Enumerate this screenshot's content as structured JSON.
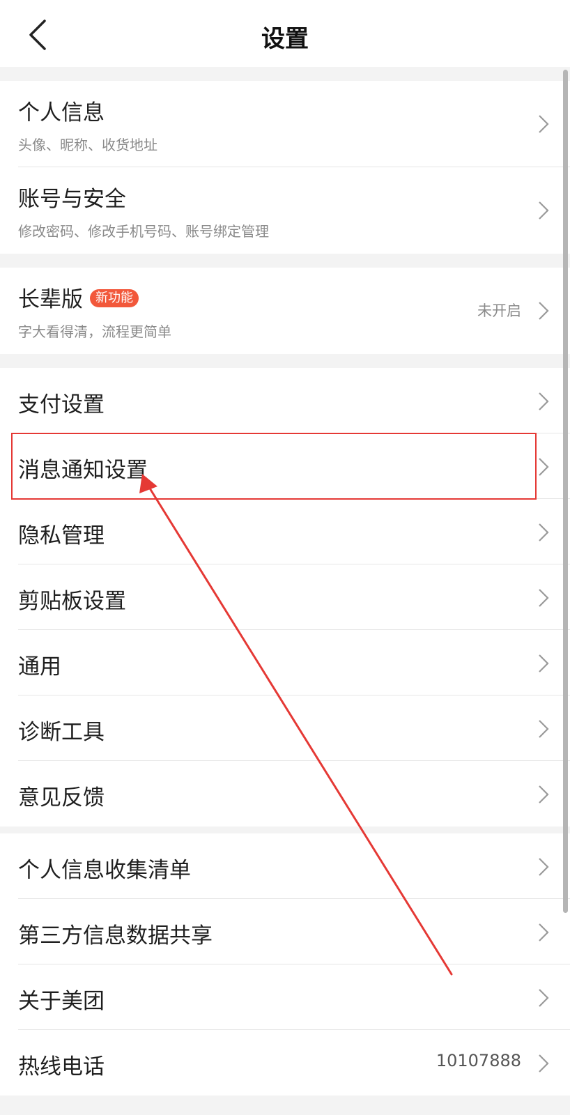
{
  "header": {
    "title": "设置",
    "back_icon": "chevron-left-icon"
  },
  "groups": [
    {
      "rows": [
        {
          "label": "个人信息",
          "sub": "头像、昵称、收货地址"
        },
        {
          "label": "账号与安全",
          "sub": "修改密码、修改手机号码、账号绑定管理"
        }
      ]
    },
    {
      "rows": [
        {
          "label": "长辈版",
          "badge": "新功能",
          "sub": "字大看得清，流程更简单",
          "value": "未开启"
        }
      ]
    },
    {
      "rows": [
        {
          "label": "支付设置"
        },
        {
          "label": "消息通知设置"
        },
        {
          "label": "隐私管理"
        },
        {
          "label": "剪贴板设置"
        },
        {
          "label": "通用"
        },
        {
          "label": "诊断工具"
        },
        {
          "label": "意见反馈"
        }
      ]
    },
    {
      "rows": [
        {
          "label": "个人信息收集清单"
        },
        {
          "label": "第三方信息数据共享"
        },
        {
          "label": "关于美团"
        },
        {
          "label": "热线电话",
          "value": "10107888"
        }
      ]
    }
  ],
  "colors": {
    "badge": "#f2583b",
    "annotation": "#e53935"
  }
}
